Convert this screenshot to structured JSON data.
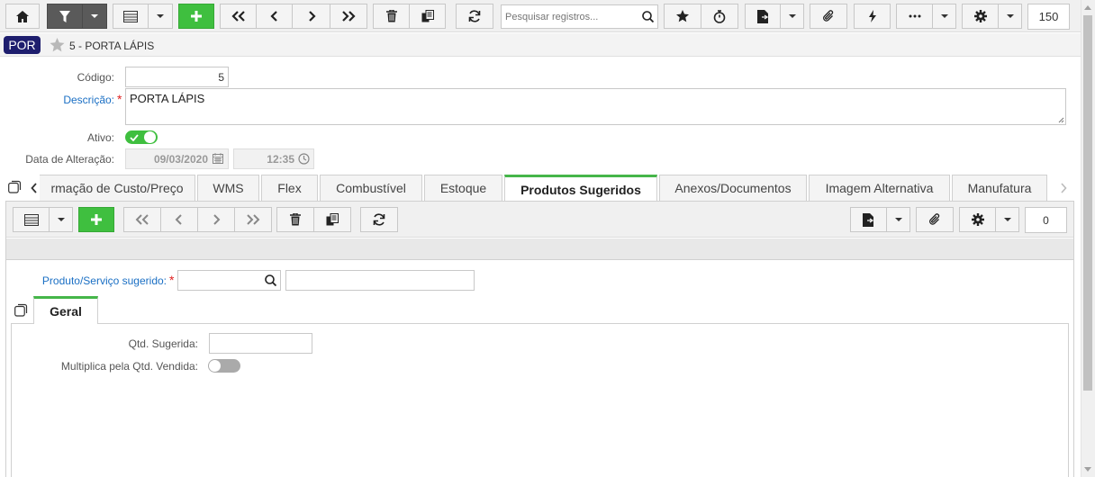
{
  "toolbar": {
    "search_placeholder": "Pesquisar registros...",
    "page_size": "150"
  },
  "header": {
    "badge": "POR",
    "title": "5 - PORTA LÁPIS"
  },
  "form": {
    "codigo_label": "Código:",
    "codigo_value": "5",
    "descricao_label": "Descrição:",
    "descricao_value": "PORTA LÁPIS",
    "ativo_label": "Ativo:",
    "ativo_value": true,
    "data_label": "Data de Alteração:",
    "data_date": "09/03/2020",
    "data_time": "12:35"
  },
  "tabs": [
    {
      "label": "rmação de Custo/Preço",
      "active": false
    },
    {
      "label": "WMS",
      "active": false
    },
    {
      "label": "Flex",
      "active": false
    },
    {
      "label": "Combustível",
      "active": false
    },
    {
      "label": "Estoque",
      "active": false
    },
    {
      "label": "Produtos Sugeridos",
      "active": true
    },
    {
      "label": "Anexos/Documentos",
      "active": false
    },
    {
      "label": "Imagem Alternativa",
      "active": false
    },
    {
      "label": "Manufatura",
      "active": false
    }
  ],
  "sub_toolbar": {
    "count": "0"
  },
  "detail": {
    "produto_label": "Produto/Serviço sugerido:",
    "produto_code": "",
    "produto_desc": "",
    "inner_tab": "Geral",
    "qtd_label": "Qtd. Sugerida:",
    "qtd_value": "",
    "multiplica_label": "Multiplica pela Qtd. Vendida:",
    "multiplica_value": false
  },
  "colors": {
    "green": "#3fbf3f",
    "badge_bg": "#1e1e6e",
    "required_label": "#1a6fc4",
    "dark_button": "#5a5a5a"
  }
}
